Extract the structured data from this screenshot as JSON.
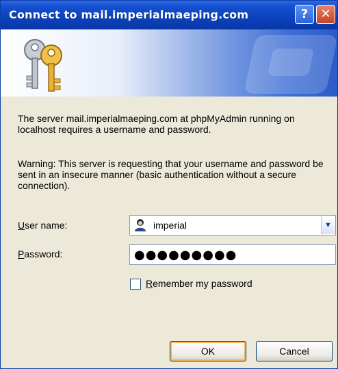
{
  "window": {
    "title": "Connect to mail.imperialmaeping.com",
    "help_glyph": "?",
    "close_glyph": "✕"
  },
  "message": {
    "server_info": "The server mail.imperialmaeping.com at phpMyAdmin running on localhost requires a username and password.",
    "warning": "Warning: This server is requesting that your username and password be sent in an insecure manner (basic authentication without a secure connection)."
  },
  "form": {
    "username_label_accel": "U",
    "username_label_rest": "ser name:",
    "username_value": "imperial",
    "password_label_accel": "P",
    "password_label_rest": "assword:",
    "password_masked": "●●●●●●●●●",
    "remember_accel": "R",
    "remember_rest": "emember my password",
    "remember_checked": false
  },
  "buttons": {
    "ok": "OK",
    "cancel": "Cancel"
  },
  "icons": {
    "title": "keys-icon",
    "user": "user-icon",
    "dropdown": "chevron-down-icon"
  },
  "colors": {
    "titlebar": "#0a3fb8",
    "dialog_bg": "#ece9d8",
    "close_button": "#c7431f",
    "default_button_focus": "#f9b55b"
  }
}
